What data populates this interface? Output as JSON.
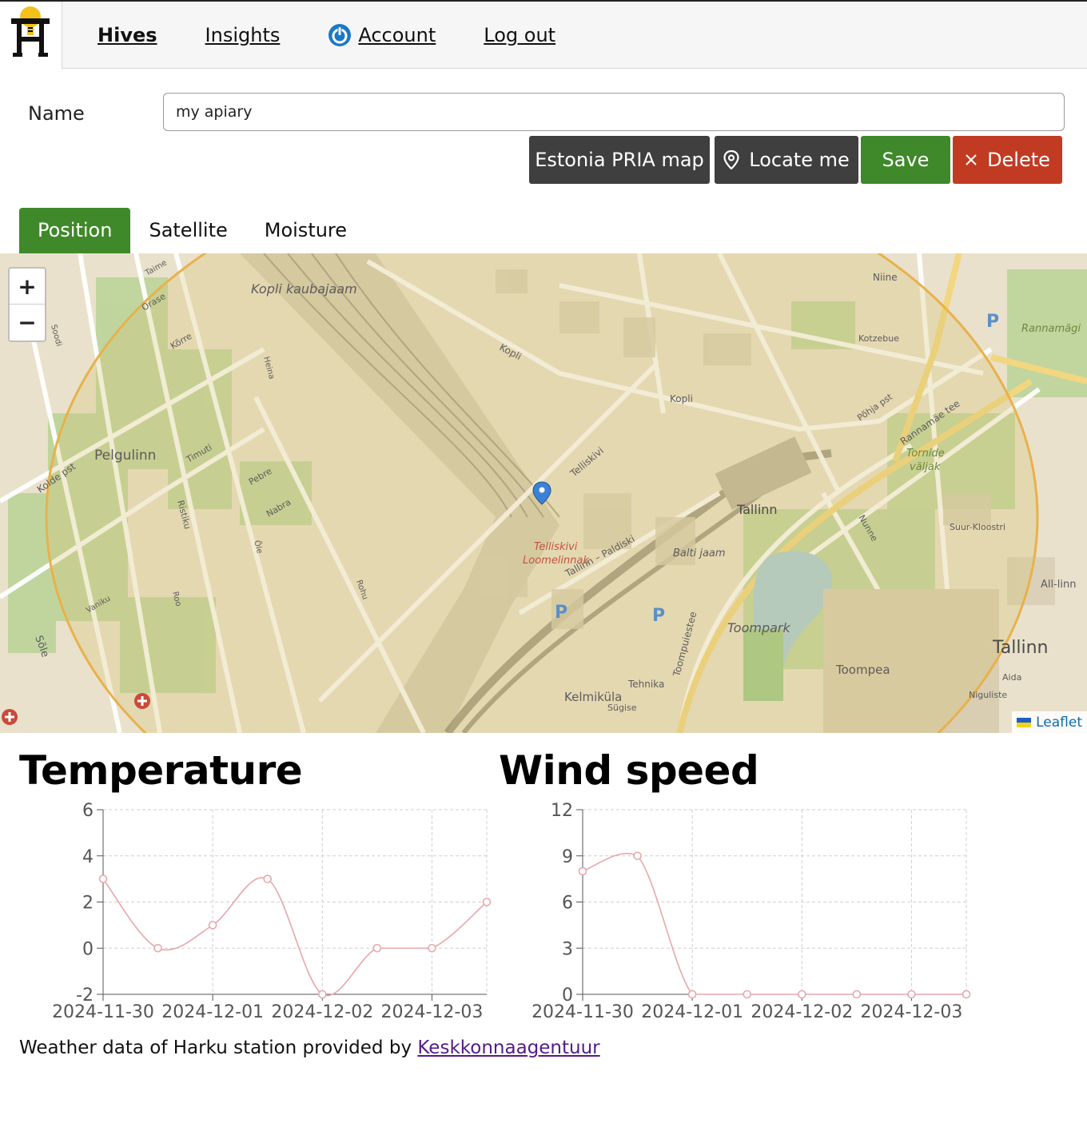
{
  "nav": {
    "items": [
      {
        "label": "Hives",
        "active": true
      },
      {
        "label": "Insights",
        "active": false
      },
      {
        "label": "Account",
        "active": false,
        "icon": "power-icon"
      },
      {
        "label": "Log out",
        "active": false
      }
    ]
  },
  "form": {
    "name_label": "Name",
    "name_value": "my apiary"
  },
  "actions": {
    "pria_label": "Estonia PRIA map",
    "locate_label": "Locate me",
    "save_label": "Save",
    "delete_label": "Delete"
  },
  "tabs": [
    {
      "label": "Position",
      "active": true
    },
    {
      "label": "Satellite",
      "active": false
    },
    {
      "label": "Moisture",
      "active": false
    }
  ],
  "map": {
    "attribution": "Leaflet",
    "zoom_in": "+",
    "zoom_out": "−",
    "labels": {
      "kopli_kaubajaam": "Kopli kaubajaam",
      "pelgulinn": "Pelgulinn",
      "tallinn_station": "Tallinn",
      "tallinn_city": "Tallinn",
      "telliskivi": "Telliskivi\nLoomelinnak",
      "balti_jaam": "Balti jaam",
      "toompark": "Toompark",
      "toompea": "Toompea",
      "kelmikula": "Kelmiküla",
      "tornide_valjak": "Tornide\nväljak",
      "rannamagi": "Rannamägi",
      "all_linn": "All-linn",
      "kolde_pst": "Kolde pst",
      "kopli": "Kopli",
      "telliskivi_street": "Telliskivi",
      "rannamae_tee": "Rannamäe tee",
      "tehnika": "Tehnika",
      "niine": "Niine",
      "kotzebue": "Kotzebue",
      "pohja_pst": "Põhja pst",
      "suur_kloostri": "Suur-Kloostri",
      "niguliste": "Niguliste",
      "sole": "Sõle",
      "ristiku": "Ristiku",
      "nabra": "Nabra",
      "pebre": "Pebre",
      "timuti": "Timuti",
      "korre": "Kõrre",
      "orase": "Orase",
      "taime": "Taime",
      "soodi": "Soodi",
      "vaniku": "Vaniku",
      "roo": "Roo",
      "ole": "Õle",
      "rohu": "Rohu",
      "heina": "Heina",
      "toompuiestee": "Toompuiestee",
      "tallinn_paldiski": "Tallinn – Paldiski",
      "kopli_top": "Kopli",
      "sugise": "Sügise",
      "aida": "Aida",
      "nunne": "Nunne"
    }
  },
  "charts": {
    "temperature_title": "Temperature",
    "wind_title": "Wind speed"
  },
  "chart_data": [
    {
      "type": "line",
      "title": "Temperature",
      "x": [
        "2024-11-30 00:00",
        "2024-11-30 12:00",
        "2024-12-01 00:00",
        "2024-12-01 12:00",
        "2024-12-02 00:00",
        "2024-12-02 12:00",
        "2024-12-03 00:00",
        "2024-12-03 12:00"
      ],
      "xtick_labels": [
        "2024-11-30",
        "2024-12-01",
        "2024-12-02",
        "2024-12-03"
      ],
      "series": [
        {
          "values": [
            3,
            0,
            1,
            3,
            -2,
            0,
            0,
            2
          ],
          "color": "#e8a7ab"
        }
      ],
      "yticks": [
        -2,
        0,
        2,
        4,
        6
      ],
      "ylim": [
        -2,
        6
      ],
      "grid": true
    },
    {
      "type": "line",
      "title": "Wind speed",
      "x": [
        "2024-11-30 00:00",
        "2024-11-30 12:00",
        "2024-12-01 00:00",
        "2024-12-01 12:00",
        "2024-12-02 00:00",
        "2024-12-02 12:00",
        "2024-12-03 00:00",
        "2024-12-03 12:00"
      ],
      "xtick_labels": [
        "2024-11-30",
        "2024-12-01",
        "2024-12-02",
        "2024-12-03"
      ],
      "series": [
        {
          "values": [
            8,
            9,
            0,
            0,
            0,
            0,
            0,
            0
          ],
          "color": "#e8a7ab"
        }
      ],
      "yticks": [
        0,
        3,
        6,
        9,
        12
      ],
      "ylim": [
        0,
        12
      ],
      "grid": true
    }
  ],
  "footer": {
    "prefix": "Weather data of Harku station provided by ",
    "link_label": "Keskkonnaagentuur"
  },
  "colors": {
    "accent_green": "#3f892a",
    "danger_red": "#c13b23",
    "dark_button": "#3f3f3f",
    "chart_line": "#e8a7ab"
  }
}
